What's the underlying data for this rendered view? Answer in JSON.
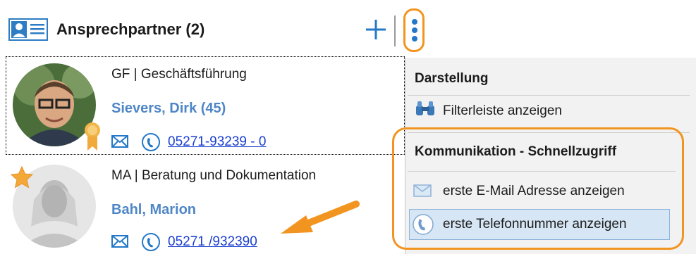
{
  "header": {
    "title": "Ansprechpartner (2)",
    "add_icon": "plus-icon",
    "more_icon": "kebab-icon"
  },
  "contacts": [
    {
      "role": "GF | Geschäftsführung",
      "name": "Sievers, Dirk (45)",
      "phone": "05271-93239 - 0",
      "badge": "ribbon-icon"
    },
    {
      "role": "MA | Beratung und Dokumentation",
      "name": "Bahl, Marion",
      "phone": "05271 /932390",
      "badge": "star-icon"
    }
  ],
  "menu": {
    "section1_header": "Darstellung",
    "filter_item": "Filterleiste anzeigen",
    "section2_header": "Kommunikation - Schnellzugriff",
    "email_item": "erste E-Mail Adresse anzeigen",
    "phone_item": "erste Telefonnummer anzeigen"
  },
  "colors": {
    "accent_orange": "#f29420",
    "link_blue": "#1a3fd0",
    "name_blue": "#4f86c6",
    "icon_blue": "#2378c7"
  }
}
